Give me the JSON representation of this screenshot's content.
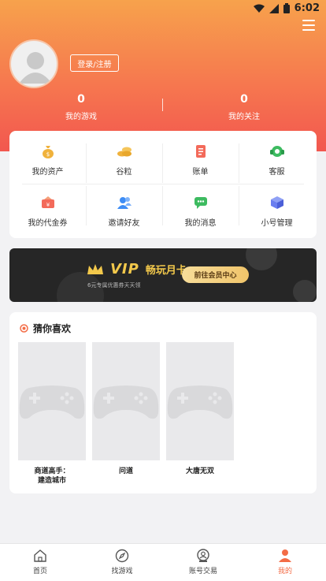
{
  "status_bar": {
    "time": "6:02"
  },
  "profile": {
    "login_label": "登录/注册",
    "stats": [
      {
        "value": "0",
        "label": "我的游戏"
      },
      {
        "value": "0",
        "label": "我的关注"
      }
    ]
  },
  "grid": {
    "items": [
      {
        "label": "我的资产",
        "icon": "money-bag-icon",
        "color": "#f0b23c"
      },
      {
        "label": "谷粒",
        "icon": "coins-icon",
        "color": "#f0b23c"
      },
      {
        "label": "账单",
        "icon": "bill-icon",
        "color": "#f36a5a"
      },
      {
        "label": "客服",
        "icon": "headset-icon",
        "color": "#3dbb60"
      },
      {
        "label": "我的代金券",
        "icon": "voucher-icon",
        "color": "#f36a5a"
      },
      {
        "label": "邀请好友",
        "icon": "invite-friends-icon",
        "color": "#3e8df5"
      },
      {
        "label": "我的消息",
        "icon": "message-icon",
        "color": "#3dbb60"
      },
      {
        "label": "小号管理",
        "icon": "cube-icon",
        "color": "#6a7ef0"
      }
    ]
  },
  "vip": {
    "badge": "VIP",
    "title": "畅玩月卡",
    "description": "6元专属优惠券天天领",
    "cta": "前往会员中心"
  },
  "guess": {
    "title": "猜你喜欢",
    "games": [
      {
        "name": "商道高手：\n建造城市"
      },
      {
        "name": "问道"
      },
      {
        "name": "大唐无双"
      }
    ]
  },
  "tabbar": {
    "tabs": [
      {
        "label": "首页",
        "icon": "home-icon"
      },
      {
        "label": "找游戏",
        "icon": "compass-icon"
      },
      {
        "label": "账号交易",
        "icon": "account-trade-icon"
      },
      {
        "label": "我的",
        "icon": "profile-icon"
      }
    ],
    "active_index": 3,
    "accent": "#f36c46"
  }
}
